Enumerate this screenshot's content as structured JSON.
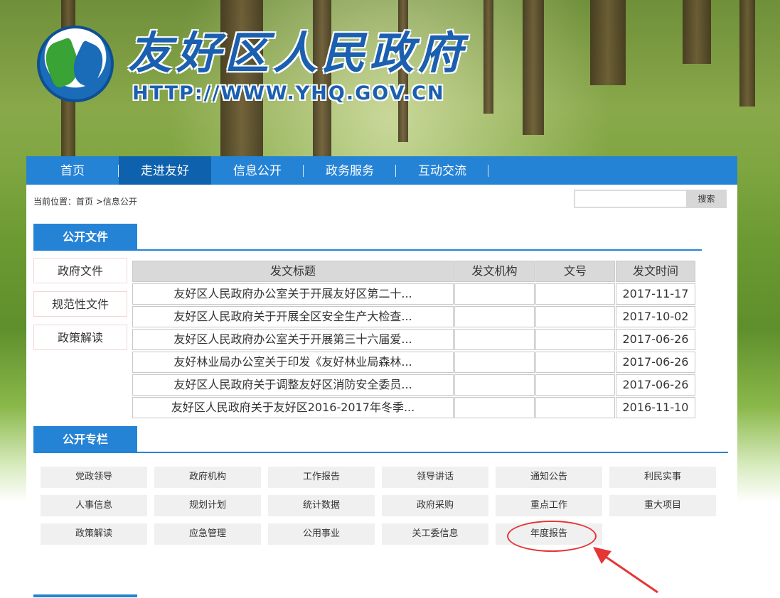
{
  "site": {
    "title": "友好区人民政府",
    "url": "HTTP://WWW.YHQ.GOV.CN"
  },
  "nav": [
    {
      "label": "首页",
      "active": false
    },
    {
      "label": "走进友好",
      "active": true
    },
    {
      "label": "信息公开",
      "active": false
    },
    {
      "label": "政务服务",
      "active": false
    },
    {
      "label": "互动交流",
      "active": false
    }
  ],
  "breadcrumb": "当前位置：首页 >信息公开",
  "search": {
    "placeholder": "",
    "button": "搜索"
  },
  "public_files": {
    "heading": "公开文件",
    "side_items": [
      "政府文件",
      "规范性文件",
      "政策解读"
    ],
    "columns": [
      "发文标题",
      "发文机构",
      "文号",
      "发文时间"
    ],
    "rows": [
      {
        "title": "友好区人民政府办公室关于开展友好区第二十...",
        "org": "",
        "num": "",
        "date": "2017-11-17"
      },
      {
        "title": "友好区人民政府关于开展全区安全生产大检查...",
        "org": "",
        "num": "",
        "date": "2017-10-02"
      },
      {
        "title": "友好区人民政府办公室关于开展第三十六届爱...",
        "org": "",
        "num": "",
        "date": "2017-06-26"
      },
      {
        "title": "友好林业局办公室关于印发《友好林业局森林...",
        "org": "",
        "num": "",
        "date": "2017-06-26"
      },
      {
        "title": "友好区人民政府关于调整友好区消防安全委员...",
        "org": "",
        "num": "",
        "date": "2017-06-26"
      },
      {
        "title": "友好区人民政府关于友好区2016-2017年冬季...",
        "org": "",
        "num": "",
        "date": "2016-11-10"
      }
    ]
  },
  "public_columns": {
    "heading": "公开专栏",
    "items": [
      "党政领导",
      "政府机构",
      "工作报告",
      "领导讲话",
      "通知公告",
      "利民实事",
      "人事信息",
      "规划计划",
      "统计数据",
      "政府采购",
      "重点工作",
      "重大项目",
      "政策解读",
      "应急管理",
      "公用事业",
      "关工委信息",
      "年度报告"
    ]
  },
  "colors": {
    "primary": "#2583d5",
    "nav_active": "#0e62ad",
    "annotation": "#e53535"
  }
}
